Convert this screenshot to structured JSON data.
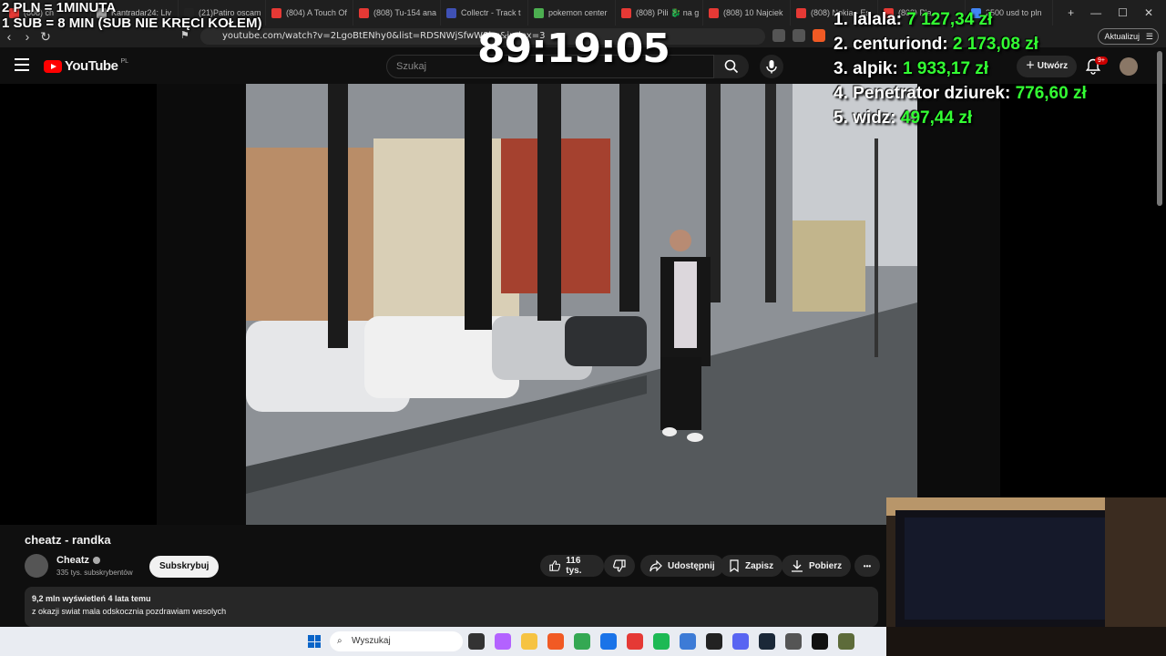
{
  "browser": {
    "tabs": [
      {
        "label": "(808) ch",
        "color": "#e53935"
      },
      {
        "label": "Kantradar24: Liv",
        "color": "#9e9e9e"
      },
      {
        "label": "(21)Patiro oscam",
        "color": "#222222"
      },
      {
        "label": "(804) A Touch Of",
        "color": "#e53935"
      },
      {
        "label": "(808) Tu-154 ana",
        "color": "#e53935"
      },
      {
        "label": "Collectr - Track t",
        "color": "#3f51b5"
      },
      {
        "label": "pokemon center",
        "color": "#4caf50"
      },
      {
        "label": "(808) Pili 🐉 na g",
        "color": "#e53935"
      },
      {
        "label": "(808) 10 Najciek",
        "color": "#e53935"
      },
      {
        "label": "(808) Nokia - Es",
        "color": "#e53935"
      },
      {
        "label": "(808) Pla",
        "color": "#e53935"
      },
      {
        "label": "2500 usd to pln",
        "color": "#4285f4"
      }
    ],
    "new_tab": "+",
    "window_controls": [
      "—",
      "☐",
      "✕"
    ],
    "url": "youtube.com/watch?v=2LgoBtENhy0&list=RDSNWjSfwW8kg&index=3",
    "update_label": "Aktualizuj"
  },
  "youtube": {
    "logo_text": "YouTube",
    "country": "PL",
    "search_placeholder": "Szukaj",
    "create_label": "Utwórz",
    "notifications": "9+"
  },
  "video": {
    "title": "cheatz - randka",
    "channel": "Cheatz",
    "subscribers": "335 tys. subskrybentów",
    "subscribe_label": "Subskrybuj",
    "likes": "116 tys.",
    "share_label": "Udostępnij",
    "save_label": "Zapisz",
    "download_label": "Pobierz",
    "more_label": "•••",
    "views_line": "9,2 mln wyświetleń  4 lata temu",
    "description": "z okazji swiat mala odskocznia pozdrawiam wesolych"
  },
  "taskbar": {
    "search_placeholder": "Wyszukaj",
    "icons": [
      {
        "name": "task-view",
        "color": "#333333"
      },
      {
        "name": "copilot",
        "color": "#b362ff"
      },
      {
        "name": "explorer",
        "color": "#f6c342"
      },
      {
        "name": "brave",
        "color": "#f15a24"
      },
      {
        "name": "chrome",
        "color": "#34a853"
      },
      {
        "name": "store",
        "color": "#1a73e8"
      },
      {
        "name": "app-red",
        "color": "#e53935"
      },
      {
        "name": "spotify",
        "color": "#1db954"
      },
      {
        "name": "notepad",
        "color": "#3d7bd6"
      },
      {
        "name": "app-dark",
        "color": "#222222"
      },
      {
        "name": "discord",
        "color": "#5865f2"
      },
      {
        "name": "steam",
        "color": "#1b2838"
      },
      {
        "name": "calculator",
        "color": "#555555"
      },
      {
        "name": "app-black",
        "color": "#111111"
      },
      {
        "name": "app-green",
        "color": "#5d6b3a"
      }
    ]
  },
  "overlay": {
    "line1": "2 PLN = 1MINUTA",
    "line2": "1 SUB = 8 MIN (SUB NIE KRĘCI KOŁEM)",
    "timer": "89:19:05",
    "leaderboard": [
      {
        "rank": "1.",
        "name": "lalala:",
        "amount": "7 127,34 zł"
      },
      {
        "rank": "2.",
        "name": "centuriond:",
        "amount": "2 173,08 zł"
      },
      {
        "rank": "3.",
        "name": "alpik:",
        "amount": "1 933,17 zł"
      },
      {
        "rank": "4.",
        "name": "Penetrator dziurek:",
        "amount": "776,60 zł"
      },
      {
        "rank": "5.",
        "name": "widz:",
        "amount": "497,44 zł"
      }
    ]
  }
}
